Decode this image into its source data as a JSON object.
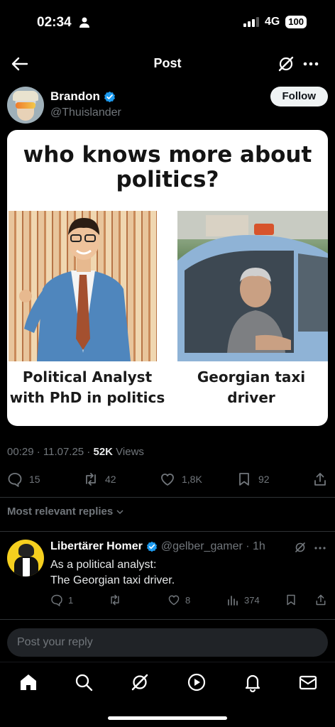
{
  "status_bar": {
    "time": "02:34",
    "network": "4G",
    "battery": "100"
  },
  "header": {
    "title": "Post"
  },
  "post": {
    "author_name": "Brandon",
    "author_handle": "@Thuislander",
    "follow_label": "Follow",
    "meme": {
      "title": "who knows more about politics?",
      "left_caption": "Political Analyst with PhD in politics",
      "right_caption": "Georgian taxi driver"
    },
    "timestamp": "00:29 · 11.07.25 · ",
    "views_count": "52K",
    "views_label": " Views",
    "stats": {
      "replies": "15",
      "reposts": "42",
      "likes": "1,8K",
      "bookmarks": "92"
    }
  },
  "replies_section": {
    "sort_label": "Most relevant replies"
  },
  "reply": {
    "name": "Libertärer Homer",
    "handle_time": "@gelber_gamer · 1h",
    "text_line1": "As a political analyst:",
    "text_line2": "The Georgian taxi driver.",
    "stats": {
      "replies": "1",
      "reposts": "",
      "likes": "8",
      "views": "374"
    }
  },
  "composer": {
    "placeholder": "Post your reply"
  },
  "colors": {
    "background": "#000000",
    "verified": "#1d9bf0",
    "muted": "#71767b"
  }
}
